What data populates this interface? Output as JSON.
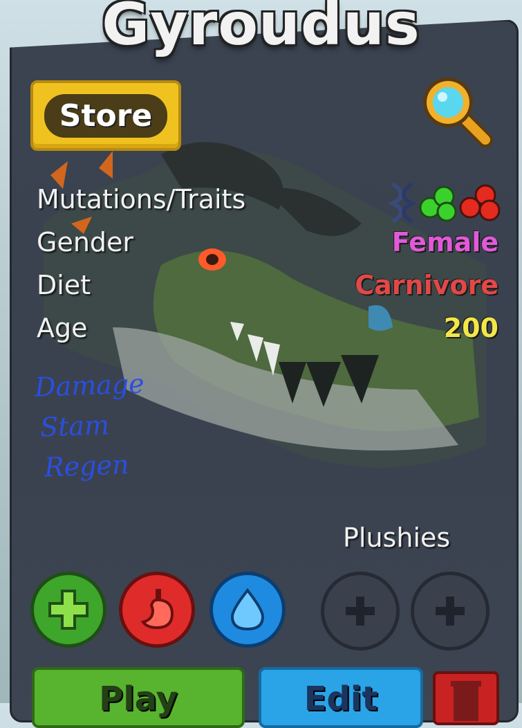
{
  "title": "Gyroudus",
  "store_button": {
    "label": "Store"
  },
  "stats": {
    "traits_label": "Mutations/Traits",
    "gender_label": "Gender",
    "gender_value": "Female",
    "diet_label": "Diet",
    "diet_value": "Carnivore",
    "age_label": "Age",
    "age_value": "200"
  },
  "notes": [
    "Damage",
    "Stam",
    "Regen"
  ],
  "plushies": {
    "label": "Plushies"
  },
  "actions": {
    "play_label": "Play",
    "edit_label": "Edit"
  },
  "icons": {
    "search": "magnifier-icon",
    "heal": "plus-icon",
    "food": "stomach-icon",
    "water": "droplet-icon",
    "plush_add": "plus-icon",
    "delete": "trash-icon",
    "traits": [
      "dna-icon",
      "green-cells-icon",
      "red-cells-icon"
    ]
  },
  "colors": {
    "gender": "#e05ad8",
    "diet": "#e24848",
    "age": "#f2e64a",
    "store": "#f0c21f",
    "play": "#58b42f",
    "edit": "#2aa4e6",
    "notes": "#2a4fe0"
  }
}
